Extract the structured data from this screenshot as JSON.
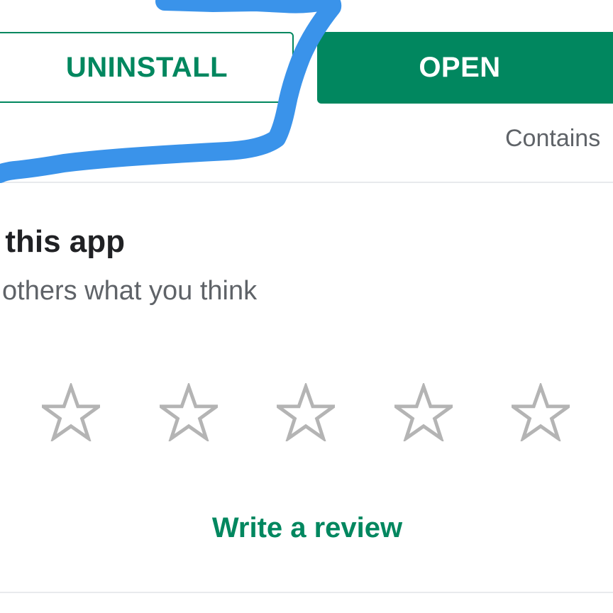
{
  "buttons": {
    "uninstall_label": "UNINSTALL",
    "open_label": "OPEN"
  },
  "contains_ads_text": "Contains",
  "rate_section": {
    "title": "te this app",
    "subtitle": "l others what you think",
    "star_count": 5,
    "rating_value": 0,
    "write_review_label": "Write a review"
  },
  "annotation": {
    "color": "#3a93ea"
  },
  "colors": {
    "accent": "#01875f",
    "divider": "#e8eaed",
    "star_outline": "#b4b4b4",
    "secondary_text": "#5f6368",
    "primary_text": "#202124"
  },
  "icons": {
    "star": "star-outline-icon"
  }
}
